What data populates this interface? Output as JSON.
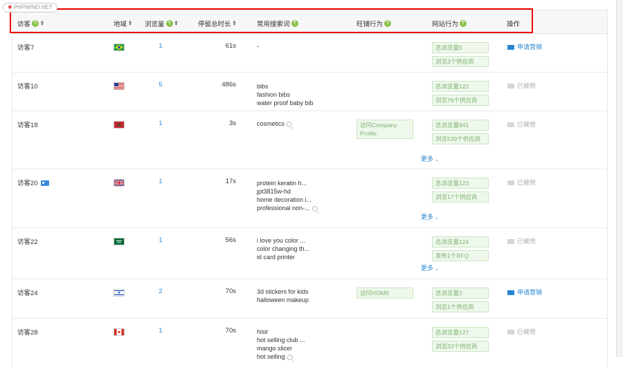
{
  "watermark": "PHPWIND.NET",
  "header": {
    "visitor": "访客",
    "region": "地域",
    "views": "浏览量",
    "stay": "停留总时长",
    "keywords": "常用搜索词",
    "wang": "旺铺行为",
    "site": "网站行为",
    "op": "操作"
  },
  "rows": [
    {
      "visitor": "访客7",
      "flag": "brazil",
      "views": "1",
      "stay": "61s",
      "keywords": [
        "-"
      ],
      "wang": [],
      "web": [
        "总浏览量5",
        "浏览3个供应商"
      ],
      "op": "申请营销",
      "op_state": "active",
      "more": ""
    },
    {
      "visitor": "访客10",
      "flag": "usa",
      "views": "5",
      "stay": "486s",
      "keywords": [
        "bibs",
        "fashion bibs",
        "water proof baby bib"
      ],
      "wang": [],
      "web": [
        "总浏览量122",
        "浏览76个供应商"
      ],
      "op": "已被抢",
      "op_state": "disabled",
      "more": ""
    },
    {
      "visitor": "访客18",
      "flag": "morocco",
      "views": "1",
      "stay": "3s",
      "keywords": [
        "cosmetics"
      ],
      "wang": [
        "访问Company Profile"
      ],
      "web": [
        "总浏览量841",
        "浏览539个供应商"
      ],
      "op": "已被抢",
      "op_state": "disabled",
      "more": "更多"
    },
    {
      "visitor": "访客20",
      "flag": "uk",
      "views": "1",
      "stay": "17s",
      "keywords": [
        "protein keratin h...",
        "jpt3815w-hd",
        "home decoration i...",
        "professional non-..."
      ],
      "wang": [],
      "web": [
        "总浏览量123",
        "浏览17个供应商"
      ],
      "op": "已被抢",
      "op_state": "disabled",
      "more": "更多"
    },
    {
      "visitor": "访客22",
      "flag": "saudi",
      "views": "1",
      "stay": "56s",
      "keywords": [
        "i love you color ...",
        "color changing th...",
        "id card printer"
      ],
      "wang": [],
      "web": [
        "总浏览量124",
        "发布1个RFQ"
      ],
      "op": "已被抢",
      "op_state": "disabled",
      "more": "更多"
    },
    {
      "visitor": "访客24",
      "flag": "israel",
      "views": "2",
      "stay": "70s",
      "keywords": [
        "3d stickers for kids",
        "halloween makeup"
      ],
      "wang": [
        "访问HOME"
      ],
      "web": [
        "总浏览量2",
        "浏览1个供应商"
      ],
      "op": "申请营销",
      "op_state": "active",
      "more": ""
    },
    {
      "visitor": "访客28",
      "flag": "canada",
      "views": "1",
      "stay": "70s",
      "keywords": [
        "hisir",
        "hot selling club ...",
        "mango slicer",
        "hot selling"
      ],
      "wang": [],
      "web": [
        "总浏览量127",
        "浏览33个供应商"
      ],
      "op": "已被抢",
      "op_state": "disabled",
      "more": ""
    }
  ]
}
